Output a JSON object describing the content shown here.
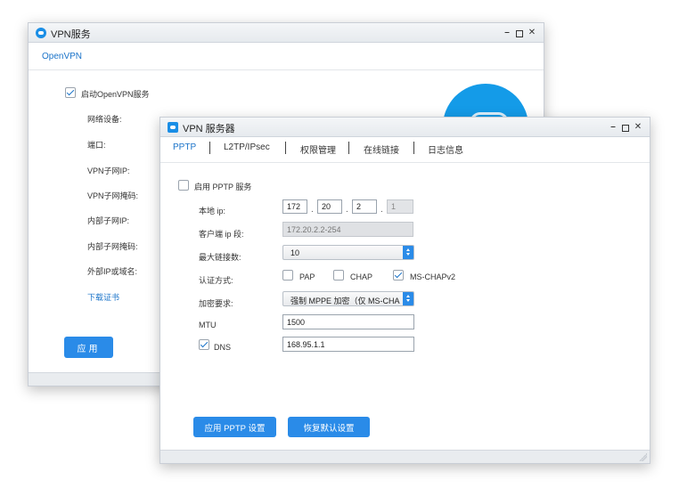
{
  "bg_window": {
    "title": "VPN服务",
    "tab": "OpenVPN",
    "enable_label": "启动OpenVPN服务",
    "enable_checked": true,
    "fields": [
      "网络设备:",
      "端口:",
      "VPN子网IP:",
      "VPN子网掩码:",
      "内部子网IP:",
      "内部子网掩码:",
      "外部IP或域名:"
    ],
    "download_link": "下载证书",
    "apply_label": "应用"
  },
  "fg_window": {
    "title": "VPN 服务器",
    "tabs": [
      "PPTP",
      "L2TP/IPsec",
      "权限管理",
      "在线链接",
      "日志信息"
    ],
    "active_tab": "PPTP",
    "enable_label": "启用 PPTP 服务",
    "enable_checked": false,
    "local_ip_label": "本地 ip:",
    "local_ip": [
      "172",
      "20",
      "2",
      "1"
    ],
    "client_range_label": "客户端 ip 段:",
    "client_range": "172.20.2.2-254",
    "max_conn_label": "最大链接数:",
    "max_conn": "10",
    "auth_label": "认证方式:",
    "auth_options": [
      {
        "label": "PAP",
        "checked": false
      },
      {
        "label": "CHAP",
        "checked": false
      },
      {
        "label": "MS-CHAPv2",
        "checked": true
      }
    ],
    "encrypt_label": "加密要求:",
    "encrypt_value": "强制 MPPE 加密（仅 MS-CHA",
    "mtu_label": "MTU",
    "mtu_value": "1500",
    "dns_label": "DNS",
    "dns_checked": true,
    "dns_value": "168.95.1.1",
    "apply_button": "应用 PPTP 设置",
    "restore_button": "恢复默认设置"
  },
  "colors": {
    "accent": "#2a8be8",
    "link": "#1a73c9"
  }
}
